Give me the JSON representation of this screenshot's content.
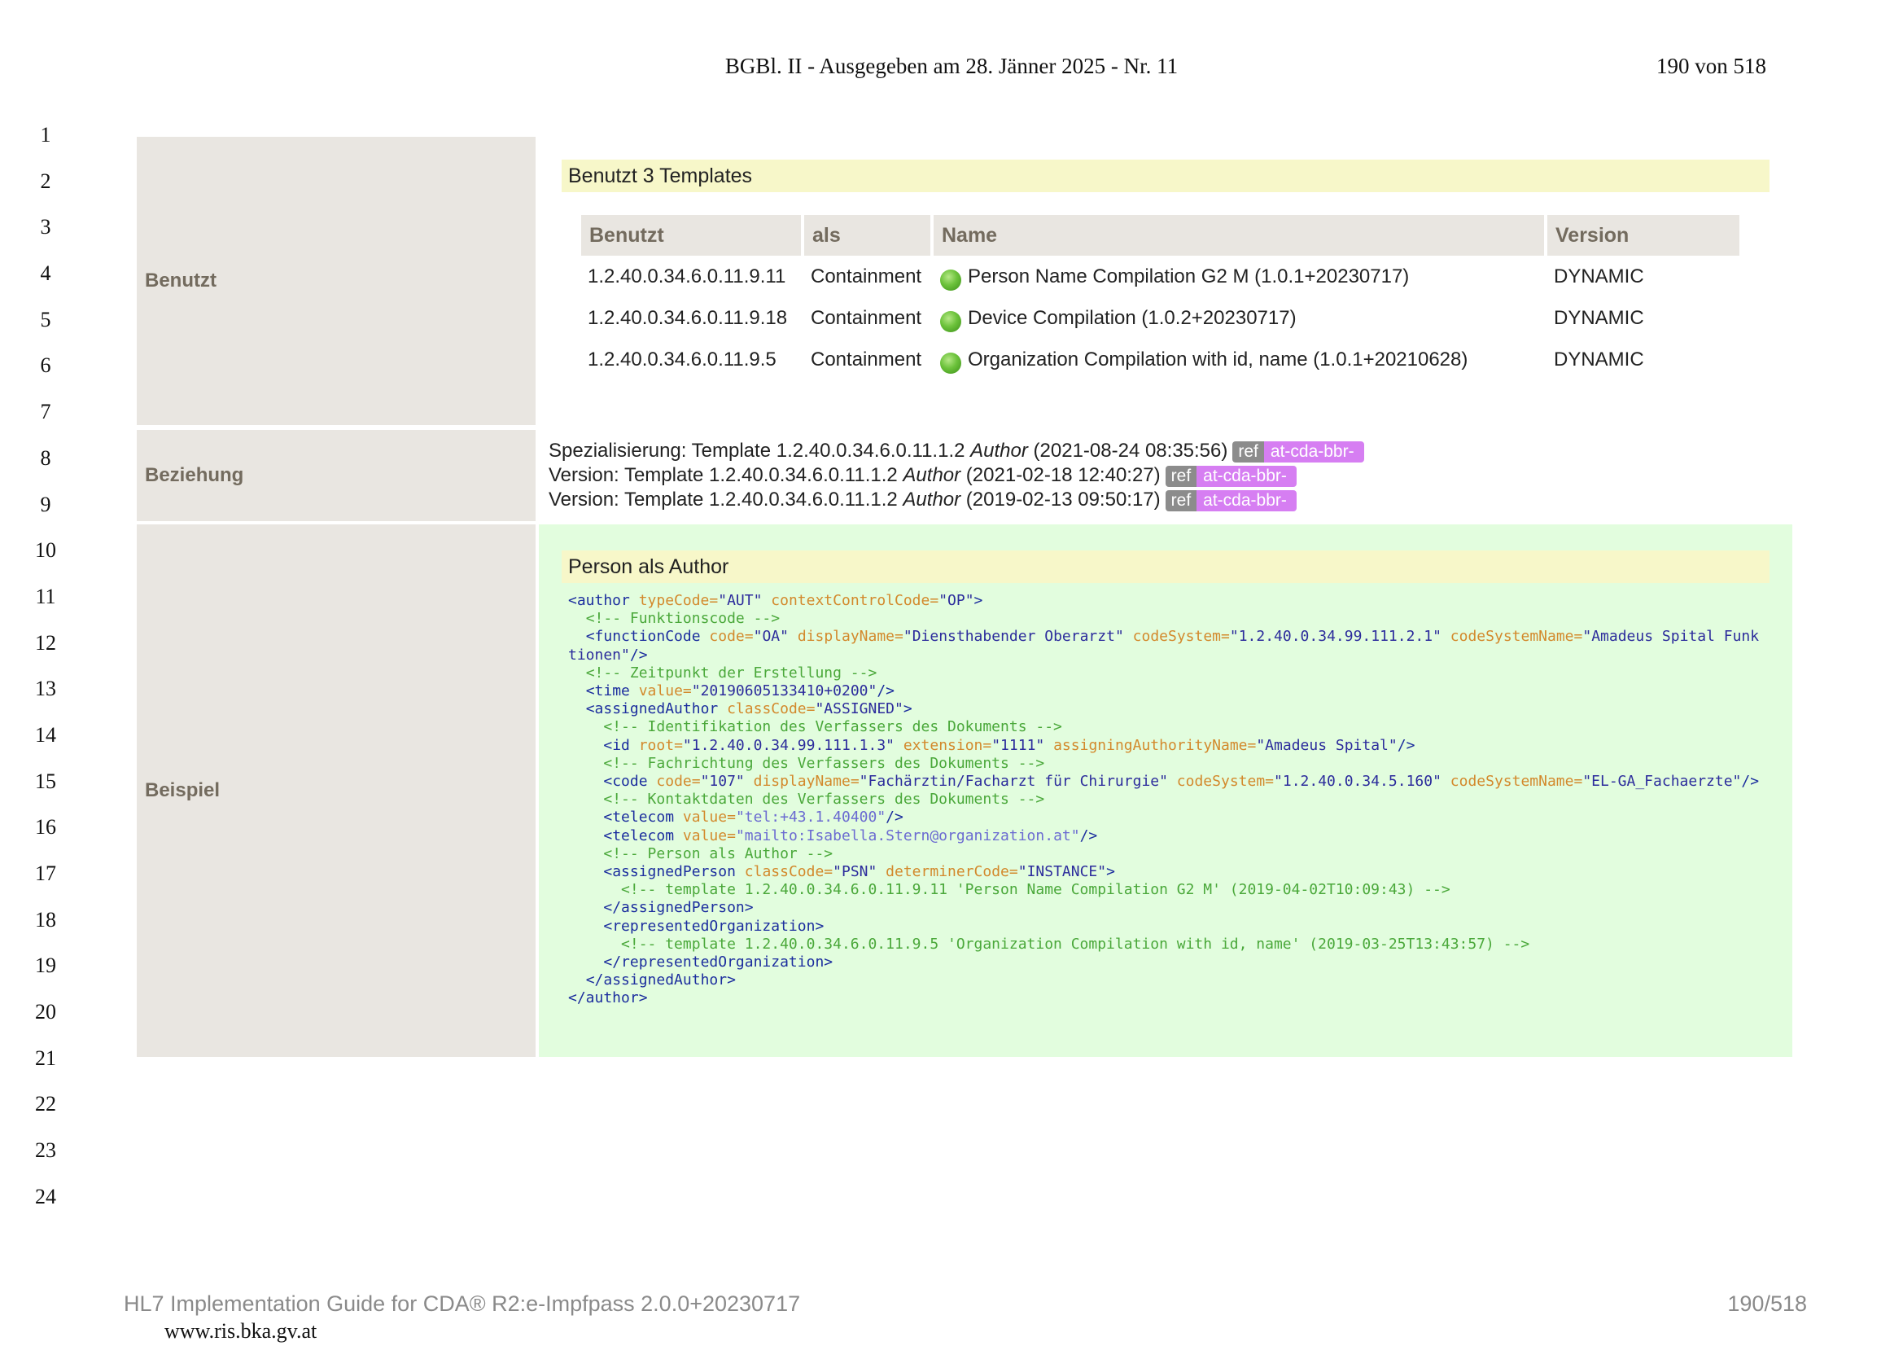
{
  "header": {
    "title": "BGBl. II - Ausgegeben am 28. Jänner 2025 - Nr. 11",
    "page": "190 von 518"
  },
  "line_numbers": [
    "1",
    "2",
    "3",
    "4",
    "5",
    "6",
    "7",
    "8",
    "9",
    "10",
    "11",
    "12",
    "13",
    "14",
    "15",
    "16",
    "17",
    "18",
    "19",
    "20",
    "21",
    "22",
    "23",
    "24"
  ],
  "benutzt": {
    "label": "Benutzt",
    "box_title": "Benutzt 3 Templates",
    "columns": [
      "Benutzt",
      "als",
      "Name",
      "Version"
    ],
    "rows": [
      {
        "id": "1.2.40.0.34.6.0.11.9.11",
        "als": "Containment",
        "name": "Person Name Compilation G2 M (1.0.1+20230717)",
        "version": "DYNAMIC"
      },
      {
        "id": "1.2.40.0.34.6.0.11.9.18",
        "als": "Containment",
        "name": "Device Compilation (1.0.2+20230717)",
        "version": "DYNAMIC"
      },
      {
        "id": "1.2.40.0.34.6.0.11.9.5",
        "als": "Containment",
        "name": "Organization Compilation with id, name (1.0.1+20210628)",
        "version": "DYNAMIC"
      }
    ],
    "status_color": "#5cb82e"
  },
  "beziehung": {
    "label": "Beziehung",
    "lines": [
      {
        "prefix": "Spezialisierung: Template 1.2.40.0.34.6.0.11.1.2 ",
        "name": "Author",
        "date": " (2021‑08‑24 08:35:56)",
        "ref": "ref",
        "pfx": "at-cda-bbr-"
      },
      {
        "prefix": "Version: Template 1.2.40.0.34.6.0.11.1.2 ",
        "name": "Author",
        "date": " (2021‑02‑18 12:40:27)",
        "ref": "ref",
        "pfx": "at-cda-bbr-"
      },
      {
        "prefix": "Version: Template 1.2.40.0.34.6.0.11.1.2 ",
        "name": "Author",
        "date": " (2019‑02‑13 09:50:17)",
        "ref": "ref",
        "pfx": "at-cda-bbr-"
      }
    ]
  },
  "beispiel": {
    "label": "Beispiel",
    "box_title": "Person als Author",
    "code": {
      "author_open": "<author",
      "typeCode_attr": "typeCode=",
      "typeCode_val": "\"AUT\"",
      "ccc_attr": "contextControlCode=",
      "ccc_val": "\"OP\"",
      "gt": ">",
      "c1": "<!-- Funktionscode -->",
      "fc_open": "<functionCode",
      "code_attr": "code=",
      "fc_code_val": "\"OA\"",
      "dn_attr": "displayName=",
      "fc_dn_val": "\"Diensthabender Oberarzt\"",
      "cs_attr": "codeSystem=",
      "fc_cs_val": "\"1.2.40.0.34.99.111.2.1\"",
      "csn_attr": "codeSystemName=",
      "fc_csn_val": "\"Amadeus Spital Funktionen\"",
      "close_empty": "/>",
      "c2": "<!-- Zeitpunkt der Erstellung -->",
      "time_open": "<time",
      "value_attr": "value=",
      "time_val": "\"20190605133410+0200\"",
      "aa_open": "<assignedAuthor",
      "classCode_attr": "classCode=",
      "aa_class_val": "\"ASSIGNED\"",
      "c3": "<!-- Identifikation des Verfassers des Dokuments -->",
      "id_open": "<id",
      "root_attr": "root=",
      "id_root_val": "\"1.2.40.0.34.99.111.1.3\"",
      "ext_attr": "extension=",
      "id_ext_val": "\"1111\"",
      "aan_attr": "assigningAuthorityName=",
      "id_aan_val": "\"Amadeus Spital\"",
      "c4": "<!-- Fachrichtung des Verfassers des Dokuments -->",
      "code_open": "<code",
      "code_code_val": "\"107\"",
      "code_dn_val": "\"Fachärztin/Facharzt für Chirurgie\"",
      "code_cs_val": "\"1.2.40.0.34.5.160\"",
      "code_csn_val": "\"EL-GA_Fachaerzte\"",
      "c5": "<!-- Kontaktdaten des Verfassers des Dokuments -->",
      "telecom_open": "<telecom",
      "tel1_val": "\"tel:+43.1.40400\"",
      "tel2_val": "\"mailto:Isabella.Stern@organization.at\"",
      "c6": "<!-- Person als Author -->",
      "ap_open": "<assignedPerson",
      "ap_class_val": "\"PSN\"",
      "det_attr": "determinerCode=",
      "ap_det_val": "\"INSTANCE\"",
      "c7": "<!-- template 1.2.40.0.34.6.0.11.9.11 'Person Name Compilation G2 M' (2019-04-02T10:09:43) -->",
      "ap_close": "</assignedPerson>",
      "ro_open": "<representedOrganization>",
      "c8": "<!-- template 1.2.40.0.34.6.0.11.9.5 'Organization Compilation with id, name' (2019-03-25T13:43:57) -->",
      "ro_close": "</representedOrganization>",
      "aa_close": "</assignedAuthor>",
      "author_close": "</author>"
    }
  },
  "footer": {
    "left": "HL7 Implementation Guide for CDA® R2:e-Impfpass 2.0.0+20230717",
    "right": "190/518",
    "url": "www.ris.bka.gv.at"
  },
  "colors": {
    "label_bg": "#e9e6e1",
    "label_text": "#736b5e",
    "title_bg": "#f7f7c9",
    "example_bg": "#e2fdde",
    "badge_ref": "#8c8c8c",
    "badge_prefix": "#d67ef2"
  }
}
